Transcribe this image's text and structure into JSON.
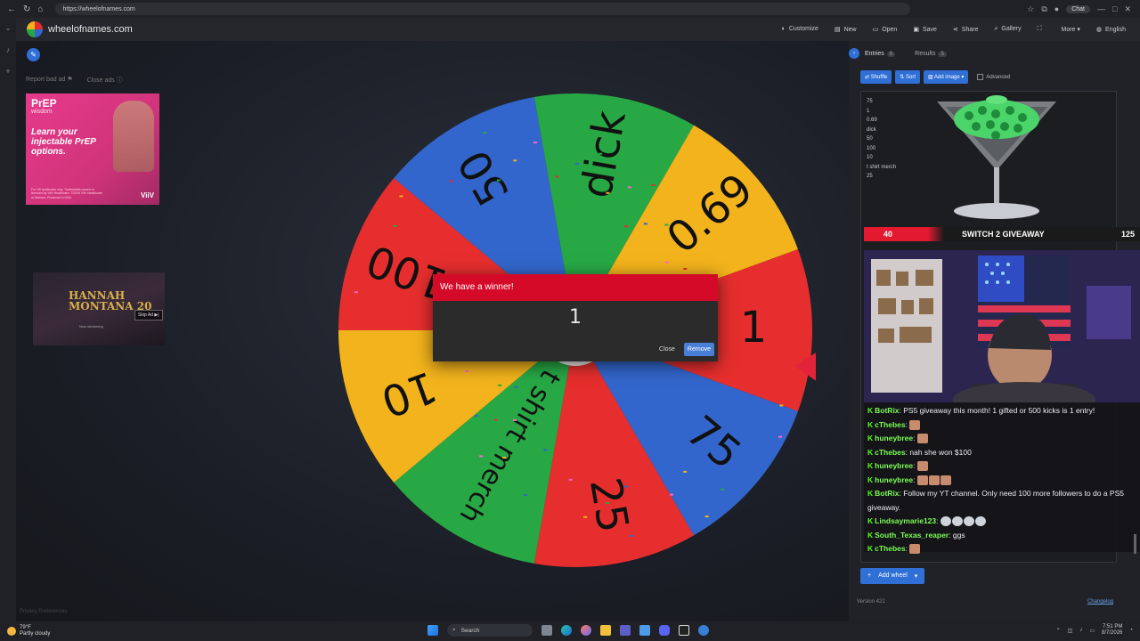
{
  "browser": {
    "url": "https://wheelofnames.com",
    "chat_label": "Chat"
  },
  "header": {
    "site_title": "wheelofnames.com",
    "menu": [
      {
        "icon": "palette-icon",
        "label": "Customize"
      },
      {
        "icon": "new-file-icon",
        "label": "New"
      },
      {
        "icon": "folder-icon",
        "label": "Open"
      },
      {
        "icon": "save-icon",
        "label": "Save"
      },
      {
        "icon": "share-icon",
        "label": "Share"
      },
      {
        "icon": "search-icon",
        "label": "Gallery"
      },
      {
        "icon": "fullscreen-icon",
        "label": ""
      },
      {
        "icon": "more-icon",
        "label": "More"
      },
      {
        "icon": "globe-icon",
        "label": "English"
      }
    ]
  },
  "ads": {
    "report_bad_ad": "Report bad ad",
    "close_ads": "Close ads",
    "prep": {
      "title": "PrEP",
      "subtitle": "wisdom",
      "body": "Learn your injectable PrEP options.",
      "brand": "ViiV",
      "fine": "For US audiences only. Trademarks owned or licensed by ViiV Healthcare. ©2026 ViiV Healthcare or licensor. Produced in USA."
    },
    "hm": {
      "title_line1": "HANNAH",
      "title_line2": "MONTANA",
      "anniversary": "20",
      "sub": "Now streaming",
      "skip_ad": "Skip Ad ▶|"
    },
    "privacy": "Privacy Preferences"
  },
  "wheel": {
    "segments": [
      {
        "label": "dick",
        "color": "#27a845"
      },
      {
        "label": "0.69",
        "color": "#f2b31c"
      },
      {
        "label": "1",
        "color": "#e62e2e"
      },
      {
        "label": "75",
        "color": "#3366cc"
      },
      {
        "label": "25",
        "color": "#e62e2e"
      },
      {
        "label": "t shirt merch",
        "color": "#27a845"
      },
      {
        "label": "10",
        "color": "#f2b31c"
      },
      {
        "label": "100",
        "color": "#e62e2e"
      },
      {
        "label": "50",
        "color": "#3366cc"
      }
    ]
  },
  "dialog": {
    "title": "We have a winner!",
    "value": "1",
    "close_label": "Close",
    "remove_label": "Remove"
  },
  "panel": {
    "tab_entries": "Entries",
    "entries_count": "9",
    "tab_results": "Results",
    "results_count": "5",
    "shuffle": "Shuffle",
    "sort": "Sort",
    "add_image": "Add image",
    "advanced": "Advanced",
    "entries": [
      "75",
      "1",
      "0.69",
      "dick",
      "50",
      "100",
      "10",
      "t shirt merch",
      "25"
    ],
    "add_wheel": "Add wheel",
    "version": "Version 421",
    "changelog": "Changelog"
  },
  "stream": {
    "giveaway_count": "40",
    "giveaway_title": "SWITCH 2 GIVEAWAY",
    "giveaway_goal": "125",
    "chat": [
      {
        "name": "BotRix",
        "text": ": PS5 giveaway this month! 1 gifted or 500 kicks is 1 entry!",
        "emotes": 0
      },
      {
        "name": "cThebes",
        "text": ":",
        "emotes": 1
      },
      {
        "name": "huneybree",
        "text": ":",
        "emotes": 1
      },
      {
        "name": "cThebes",
        "text": ": nah she won $100",
        "emotes": 0
      },
      {
        "name": "huneybree",
        "text": ":",
        "emotes": 1
      },
      {
        "name": "huneybree",
        "text": ":",
        "emotes": 3
      },
      {
        "name": "BotRix",
        "text": ": Follow my YT channel. Only need 100 more followers to do a PS5 giveaway.",
        "emotes": 0
      },
      {
        "name": "Lindsaymarie123",
        "text": ":",
        "emotes": 4,
        "face": true
      },
      {
        "name": "South_Texas_reaper",
        "text": ": ggs",
        "emotes": 0
      },
      {
        "name": "cThebes",
        "text": ":",
        "emotes": 1
      }
    ]
  },
  "taskbar": {
    "temp": "79°F",
    "weather": "Partly cloudy",
    "search": "Search",
    "time": "7:51 PM",
    "date": "8/7/2026"
  }
}
